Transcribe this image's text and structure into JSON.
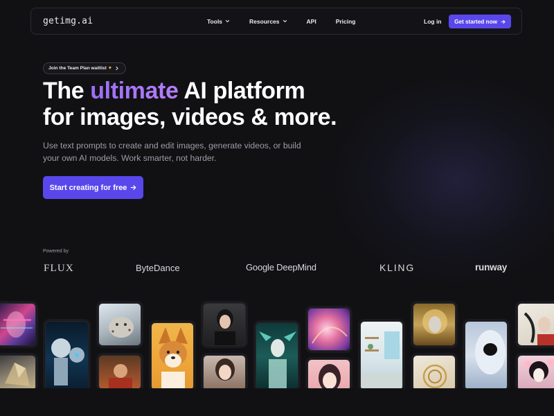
{
  "nav": {
    "logo": "getimg.ai",
    "links": [
      {
        "label": "Tools",
        "has_dropdown": true
      },
      {
        "label": "Resources",
        "has_dropdown": true
      },
      {
        "label": "API",
        "has_dropdown": false
      },
      {
        "label": "Pricing",
        "has_dropdown": false
      }
    ],
    "login": "Log in",
    "cta": "Get started now"
  },
  "hero": {
    "pill": "Join the Team Plan waitlist",
    "title_pre": "The ",
    "title_accent": "ultimate",
    "title_post": " AI platform",
    "title_line2": "for images, videos & more.",
    "subtitle": "Use text prompts to create and edit images, generate videos, or build your own AI models. Work smarter, not harder.",
    "cta": "Start creating for free"
  },
  "powered_by": {
    "label": "Powered by",
    "brands": [
      "FLUX",
      "ByteDance",
      "Google DeepMind",
      "KLING",
      "runway"
    ]
  },
  "colors": {
    "background": "#111114",
    "accent": "#5a47ec",
    "gradient_text": "#a472f8",
    "muted_text": "#9d9da6"
  },
  "icons": [
    "chevron-down-icon",
    "arrow-right-icon",
    "chevron-right-icon",
    "heart-icon"
  ]
}
